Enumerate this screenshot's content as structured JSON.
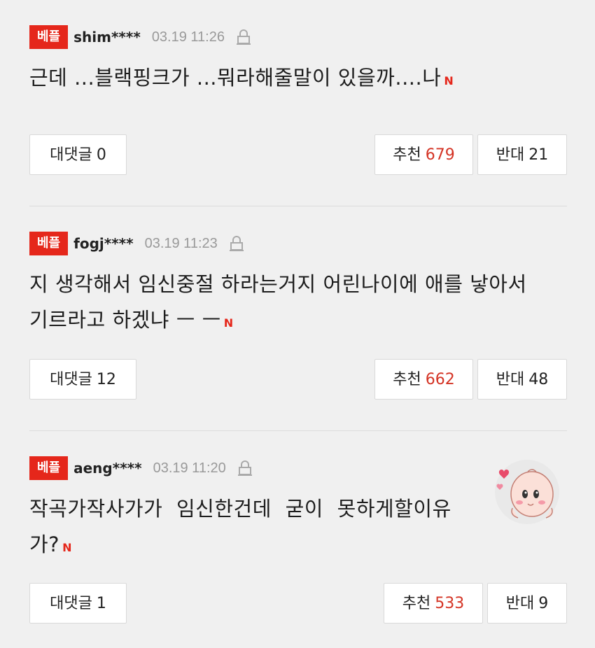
{
  "comments": [
    {
      "badge": "베플",
      "user": "shim****",
      "time": "03.19 11:26",
      "text": "근데 ...블랙핑크가 ...뭐라해줄말이 있을까....나",
      "new_icon": "N",
      "reply_label": "대댓글",
      "reply_count": "0",
      "like_label": "추천",
      "like_count": "679",
      "dislike_label": "반대",
      "dislike_count": "21"
    },
    {
      "badge": "베플",
      "user": "fogj****",
      "time": "03.19 11:23",
      "text_line1": "지 생각해서 임신중절 하라는거지 어린나이에 애를 낳아서",
      "text_line2": "기르라고 하겠냐 ㅡ ㅡ",
      "new_icon": "N",
      "reply_label": "대댓글",
      "reply_count": "12",
      "like_label": "추천",
      "like_count": "662",
      "dislike_label": "반대",
      "dislike_count": "48"
    },
    {
      "badge": "베플",
      "user": "aeng****",
      "time": "03.19 11:20",
      "text_line1": "작곡가작사가가 임신한건데 굳이 못하게할이유",
      "text_line2": "가?",
      "new_icon": "N",
      "reply_label": "대댓글",
      "reply_count": "1",
      "like_label": "추천",
      "like_count": "533",
      "dislike_label": "반대",
      "dislike_count": "9"
    }
  ],
  "icons": {
    "report": "lock-icon",
    "new": "new-icon",
    "sticker": "sticker-character"
  },
  "colors": {
    "badge": "#e5271b",
    "like_count": "#d43425",
    "background": "#f0f0f0"
  }
}
